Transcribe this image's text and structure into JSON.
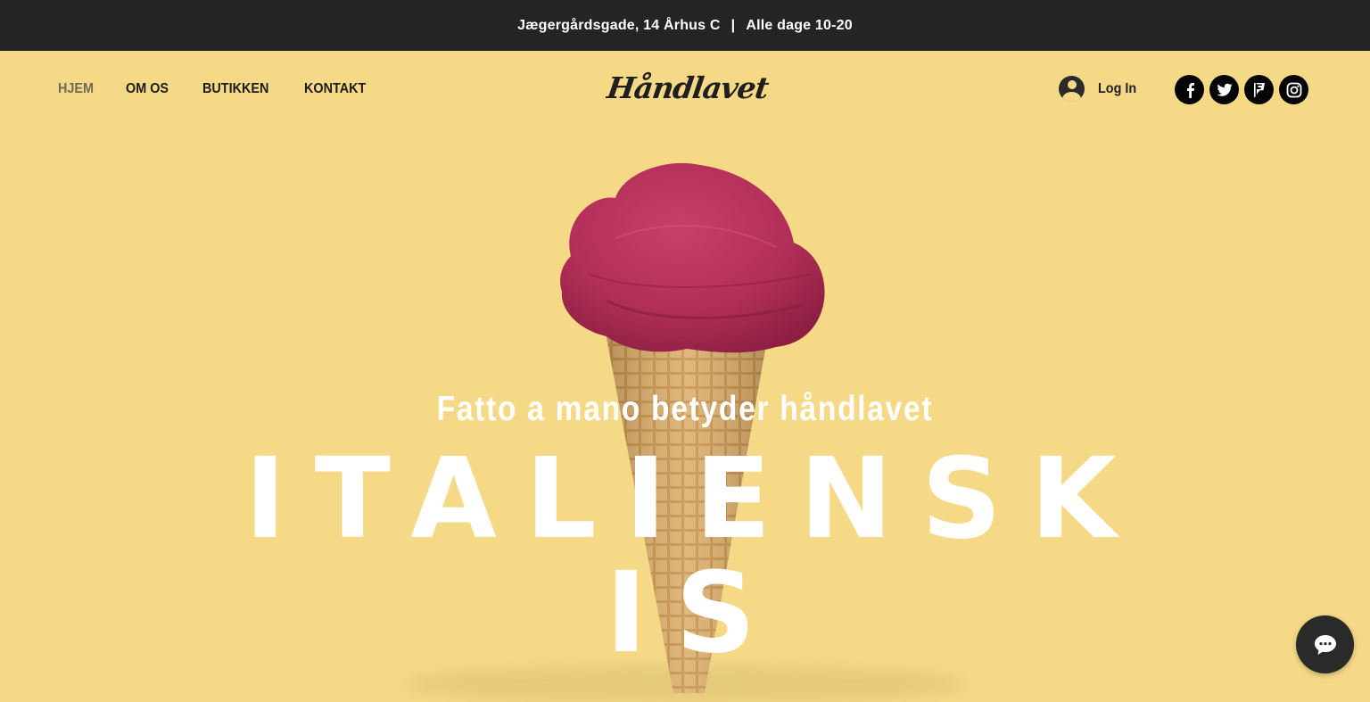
{
  "topbar": {
    "address": "Jægergårdsgade, 14 Århus C",
    "separator": "|",
    "hours": "Alle dage 10-20"
  },
  "nav": {
    "items": [
      {
        "label": "HJEM",
        "active": true
      },
      {
        "label": "OM OS",
        "active": false
      },
      {
        "label": "BUTIKKEN",
        "active": false
      },
      {
        "label": "KONTAKT",
        "active": false
      }
    ]
  },
  "logo": {
    "text": "Håndlavet"
  },
  "login": {
    "label": "Log In",
    "icon": "user-avatar-icon"
  },
  "socials": [
    {
      "name": "facebook-icon"
    },
    {
      "name": "twitter-icon"
    },
    {
      "name": "foursquare-icon"
    },
    {
      "name": "instagram-icon"
    }
  ],
  "hero": {
    "tagline": "Fatto a mano betyder håndlavet",
    "headline_line1": "ITALIENSK",
    "headline_line2": "IS"
  },
  "chat": {
    "icon": "chat-bubble-icon"
  },
  "colors": {
    "background": "#f5d986",
    "topbar": "#242424",
    "text_dark": "#1c1c1c",
    "nav_active": "#6e6a5a",
    "scoop": "#b8335a",
    "cone": "#d9a963"
  }
}
